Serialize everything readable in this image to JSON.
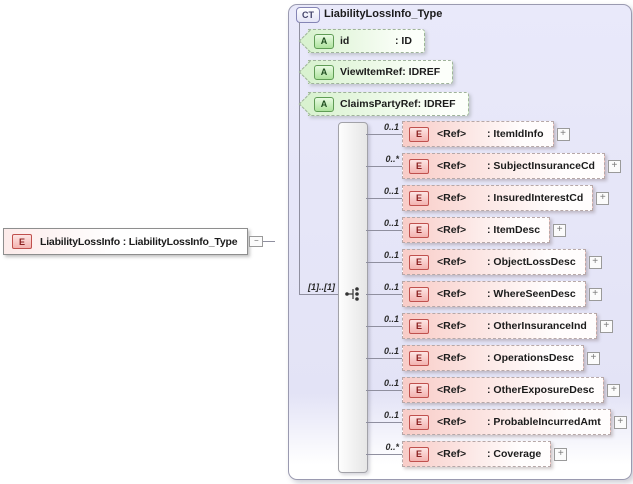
{
  "icons": {
    "element": "E",
    "attribute": "A",
    "complex_type": "CT",
    "expand": "+",
    "collapse": "−"
  },
  "root": {
    "label": "LiabilityLossInfo : LiabilityLossInfo_Type"
  },
  "complex_type": {
    "title": "LiabilityLossInfo_Type",
    "attributes": [
      {
        "name": "id",
        "type": ": ID"
      },
      {
        "name": "ViewItemRef",
        "type": ": IDREF"
      },
      {
        "name": "ClaimsPartyRef",
        "type": ": IDREF"
      }
    ],
    "compositor": {
      "kind": "sequence",
      "occurrence": "[1]..[1]"
    },
    "elements": [
      {
        "cardinality": "0..1",
        "ref": "<Ref>",
        "type": ": ItemIdInfo"
      },
      {
        "cardinality": "0..*",
        "ref": "<Ref>",
        "type": ": SubjectInsuranceCd"
      },
      {
        "cardinality": "0..1",
        "ref": "<Ref>",
        "type": ": InsuredInterestCd"
      },
      {
        "cardinality": "0..1",
        "ref": "<Ref>",
        "type": ": ItemDesc"
      },
      {
        "cardinality": "0..1",
        "ref": "<Ref>",
        "type": ": ObjectLossDesc"
      },
      {
        "cardinality": "0..1",
        "ref": "<Ref>",
        "type": ": WhereSeenDesc"
      },
      {
        "cardinality": "0..1",
        "ref": "<Ref>",
        "type": ": OtherInsuranceInd"
      },
      {
        "cardinality": "0..1",
        "ref": "<Ref>",
        "type": ": OperationsDesc"
      },
      {
        "cardinality": "0..1",
        "ref": "<Ref>",
        "type": ": OtherExposureDesc"
      },
      {
        "cardinality": "0..1",
        "ref": "<Ref>",
        "type": ": ProbableIncurredAmt"
      },
      {
        "cardinality": "0..*",
        "ref": "<Ref>",
        "type": ": Coverage"
      }
    ]
  },
  "colors": {
    "container_fill": "#e8e8f9",
    "attribute_fill": "#d9f2d0",
    "element_fill": "#f8ccc7",
    "element_icon_border": "#c0504d",
    "attribute_icon_border": "#5f9c55",
    "line": "#8f8f9f"
  }
}
